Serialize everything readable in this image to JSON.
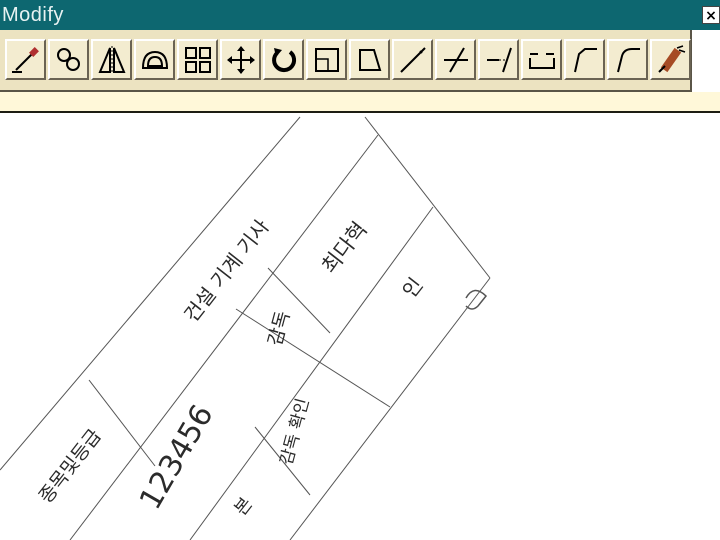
{
  "window": {
    "title": "Modify",
    "close_label": "×"
  },
  "toolbar": {
    "tools": [
      {
        "icon": "erase-icon"
      },
      {
        "icon": "copy-icon"
      },
      {
        "icon": "mirror-icon"
      },
      {
        "icon": "offset-icon"
      },
      {
        "icon": "array-icon"
      },
      {
        "icon": "move-icon"
      },
      {
        "icon": "rotate-icon"
      },
      {
        "icon": "scale-icon"
      },
      {
        "icon": "stretch-icon"
      },
      {
        "icon": "lengthen-icon"
      },
      {
        "icon": "trim-icon"
      },
      {
        "icon": "extend-icon"
      },
      {
        "icon": "break-icon"
      },
      {
        "icon": "chamfer-icon"
      },
      {
        "icon": "fillet-icon"
      },
      {
        "icon": "explode-icon"
      }
    ]
  },
  "drawing": {
    "texts": {
      "qualification": "건설 기계 기사",
      "number_header": "종목및등급",
      "number_value": "123456",
      "chief_label": "감독",
      "chief_value": "최다혁",
      "confirm_label": "감독 확인",
      "seal": "인",
      "unit": "본"
    }
  }
}
